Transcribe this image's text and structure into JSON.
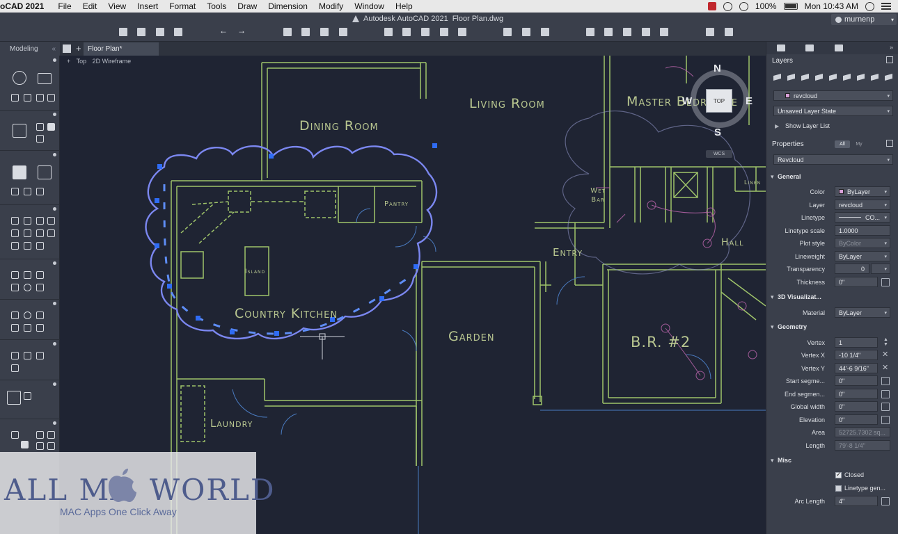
{
  "menubar": {
    "app": "oCAD 2021",
    "items": [
      "File",
      "Edit",
      "View",
      "Insert",
      "Format",
      "Tools",
      "Draw",
      "Dimension",
      "Modify",
      "Window",
      "Help"
    ],
    "battery": "100%",
    "clock": "Mon 10:43 AM"
  },
  "window": {
    "title": "Autodesk AutoCAD 2021",
    "document": "Floor Plan.dwg",
    "user": "murnenp"
  },
  "tabs": {
    "workspace": "Modeling",
    "document_tab": "Floor Plan*"
  },
  "viewport": {
    "controls": "+",
    "view": "Top",
    "style": "2D Wireframe"
  },
  "viewcube": {
    "n": "N",
    "s": "S",
    "e": "E",
    "w": "W",
    "face": "TOP",
    "wcs": "WCS"
  },
  "rooms": {
    "dining": "Dining Room",
    "living": "Living Room",
    "master": "Master Bedroome",
    "pantry": "Pantry",
    "island": "Island",
    "kitchen": "Country Kitchen",
    "garden": "Garden",
    "entry": "Entry",
    "hall": "Hall",
    "br2": "B.R. #2",
    "laundry": "Laundry",
    "wet_bar": "Wet Bar",
    "linen": "Linen"
  },
  "watermark": {
    "left": "ALL MA",
    "right": "WORLD",
    "subtitle": "MAC Apps One Click Away"
  },
  "layers_panel": {
    "title": "Layers",
    "current_layer": "revcloud",
    "layer_state": "Unsaved Layer State",
    "show_list": "Show Layer List"
  },
  "properties_panel": {
    "title": "Properties",
    "filter_all": "All",
    "filter_my": "My",
    "object": "Revcloud",
    "sections": {
      "general": "General",
      "visualization": "3D Visualizat...",
      "geometry": "Geometry",
      "misc": "Misc"
    },
    "general": [
      {
        "label": "Color",
        "value": "ByLayer"
      },
      {
        "label": "Layer",
        "value": "revcloud"
      },
      {
        "label": "Linetype",
        "value": "CO..."
      },
      {
        "label": "Linetype scale",
        "value": "1.0000"
      },
      {
        "label": "Plot style",
        "value": "ByColor"
      },
      {
        "label": "Lineweight",
        "value": "ByLayer"
      },
      {
        "label": "Transparency",
        "value": "0"
      },
      {
        "label": "Thickness",
        "value": "0\""
      }
    ],
    "visualization": [
      {
        "label": "Material",
        "value": "ByLayer"
      }
    ],
    "geometry": [
      {
        "label": "Vertex",
        "value": "1"
      },
      {
        "label": "Vertex X",
        "value": "-10 1/4\""
      },
      {
        "label": "Vertex Y",
        "value": "44'-6 9/16\""
      },
      {
        "label": "Start segme...",
        "value": "0\""
      },
      {
        "label": "End segmen...",
        "value": "0\""
      },
      {
        "label": "Global width",
        "value": "0\""
      },
      {
        "label": "Elevation",
        "value": "0\""
      },
      {
        "label": "Area",
        "value": "52725.7302 sq..."
      },
      {
        "label": "Length",
        "value": "79'-8 1/4\""
      }
    ],
    "misc": {
      "closed": "Closed",
      "linetype_gen": "Linetype gen...",
      "arc_length_label": "Arc Length",
      "arc_length_value": "4\""
    }
  },
  "colors": {
    "walls": "#9fc46a",
    "revcloud": "#7b87f0",
    "grip": "#2f6cf5",
    "background": "#1f2433",
    "magenta": "#c25aa5"
  }
}
